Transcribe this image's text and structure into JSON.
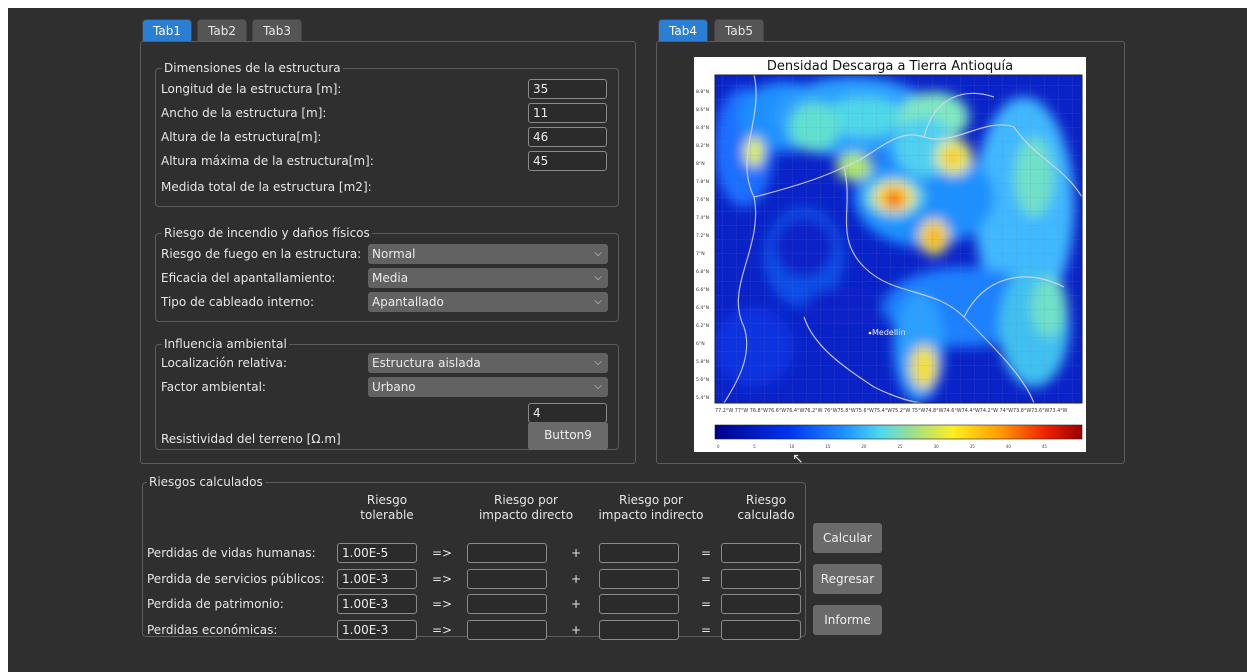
{
  "left_tabs": [
    "Tab1",
    "Tab2",
    "Tab3"
  ],
  "right_tabs": [
    "Tab4",
    "Tab5"
  ],
  "dimensiones": {
    "title": "Dimensiones de la estructura",
    "rows": [
      {
        "label": "Longitud de la estructura [m]:",
        "value": "35"
      },
      {
        "label": "Ancho de la estructura [m]:",
        "value": "11"
      },
      {
        "label": "Altura de la estructura[m]:",
        "value": "46"
      },
      {
        "label": "Altura máxima de la estructura[m]:",
        "value": "45"
      }
    ],
    "total_label": "Medida total de la estructura [m2]:"
  },
  "riesgo_incendio": {
    "title": "Riesgo de incendio y daños físicos",
    "rows": [
      {
        "label": "Riesgo de fuego en la estructura:",
        "value": "Normal"
      },
      {
        "label": "Eficacia del apantallamiento:",
        "value": "Media"
      },
      {
        "label": "Tipo de cableado interno:",
        "value": "Apantallado"
      }
    ]
  },
  "influencia": {
    "title": "Influencia ambiental",
    "rows": [
      {
        "label": "Localización relativa:",
        "value": "Estructura aislada"
      },
      {
        "label": "Factor ambiental:",
        "value": "Urbano"
      }
    ],
    "resistividad_label": "Resistividad del terreno [Ω.m]",
    "resistividad_value": "4",
    "button9": "Button9"
  },
  "map": {
    "title": "Densidad Descarga a Tierra Antioquía",
    "city": "Medellín",
    "lat_labels": [
      "8.8°N",
      "8.6°N",
      "8.4°N",
      "8.2°N",
      "8°N",
      "7.8°N",
      "7.6°N",
      "7.4°N",
      "7.2°N",
      "7°N",
      "6.8°N",
      "6.6°N",
      "6.4°N",
      "6.2°N",
      "6°N",
      "5.8°N",
      "5.6°N",
      "5.4°N"
    ],
    "lon_labels": "77.2°W 77°W 76.8°W76.6°W76.4°W76.2°W 76°W75.8°W75.6°W75.4°W75.2°W 75°W74.8°W74.6°W74.4°W74.2°W 74°W73.8°W73.6°W73.4°W",
    "colorbar_ticks": [
      "0",
      "5",
      "10",
      "15",
      "20",
      "25",
      "30",
      "35",
      "40",
      "45"
    ]
  },
  "riesgos": {
    "title": "Riesgos calculados",
    "headers": [
      "Riesgo\ntolerable",
      "Riesgo por\nimpacto directo",
      "Riesgo por\nimpacto indirecto",
      "Riesgo\ncalculado"
    ],
    "rows": [
      {
        "label": "Perdidas de vidas humanas:",
        "tolerable": "1.00E-5"
      },
      {
        "label": "Perdida de servicios públicos:",
        "tolerable": "1.00E-3"
      },
      {
        "label": "Perdida de patrimonio:",
        "tolerable": "1.00E-3"
      },
      {
        "label": "Perdidas económicas:",
        "tolerable": "1.00E-3"
      }
    ],
    "arrow": "=>",
    "plus": "+",
    "equals": "="
  },
  "buttons": {
    "calcular": "Calcular",
    "regresar": "Regresar",
    "informe": "Informe"
  }
}
